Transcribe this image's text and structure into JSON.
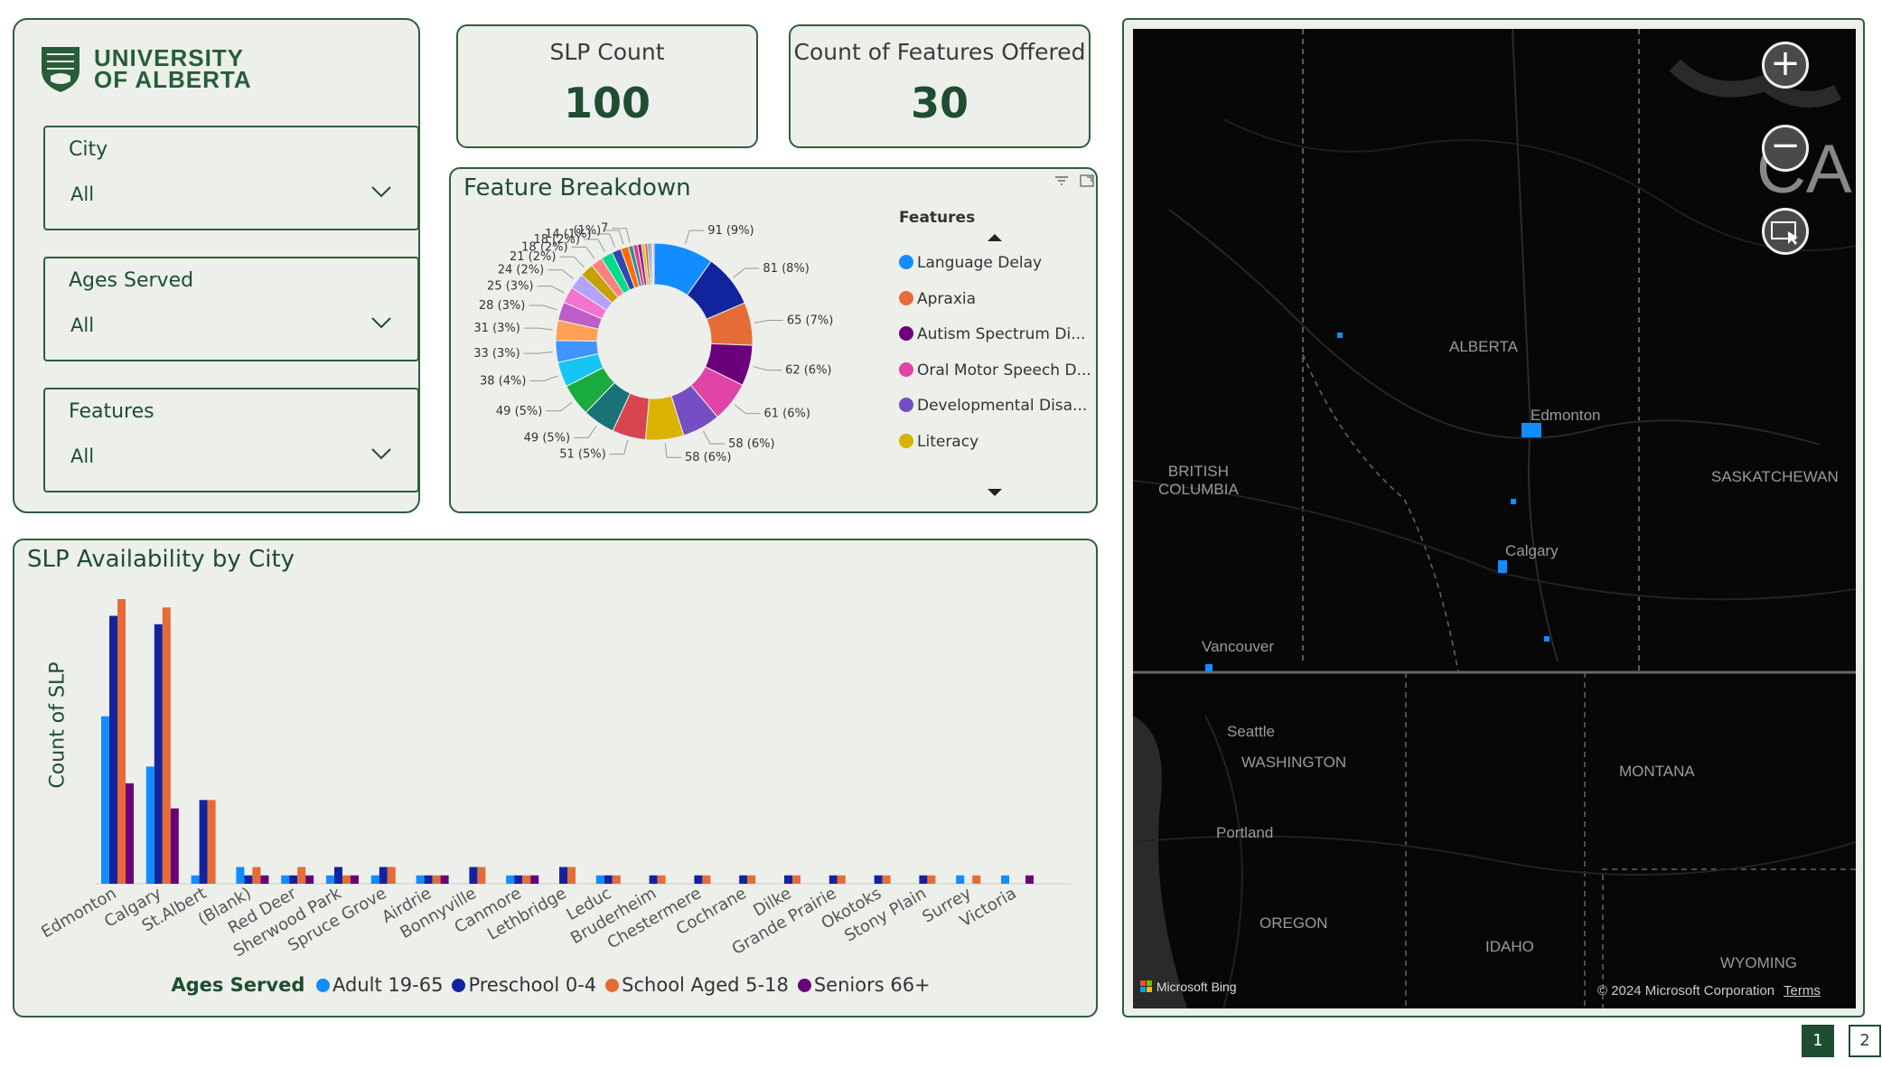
{
  "logo": {
    "line1": "UNIVERSITY",
    "line2": "OF ALBERTA"
  },
  "slicers": [
    {
      "title": "City",
      "value": "All"
    },
    {
      "title": "Ages Served",
      "value": "All"
    },
    {
      "title": "Features",
      "value": "All"
    }
  ],
  "kpis": [
    {
      "title": "SLP Count",
      "value": "100"
    },
    {
      "title": "Count of Features Offered",
      "value": "30"
    }
  ],
  "feature_breakdown": {
    "title": "Feature Breakdown",
    "legend_title": "Features",
    "legend_items": [
      {
        "label": "Language Delay",
        "color": "#118dff"
      },
      {
        "label": "Apraxia",
        "color": "#e66c37"
      },
      {
        "label": "Autism Spectrum Di...",
        "color": "#6b007b"
      },
      {
        "label": "Oral Motor Speech D...",
        "color": "#e044a7"
      },
      {
        "label": "Developmental Disa...",
        "color": "#744ec2"
      },
      {
        "label": "Literacy",
        "color": "#d9b300"
      }
    ]
  },
  "availability": {
    "title": "SLP Availability by City",
    "ylabel": "Count of SLP",
    "legend_title": "Ages Served"
  },
  "map": {
    "labels": {
      "alberta": "ALBERTA",
      "bc1": "BRITISH",
      "bc2": "COLUMBIA",
      "saskatchewan": "SASKATCHEWAN",
      "edmonton": "Edmonton",
      "calgary": "Calgary",
      "vancouver": "Vancouver",
      "seattle": "Seattle",
      "washington": "WASHINGTON",
      "montana": "MONTANA",
      "portland": "Portland",
      "oregon": "OREGON",
      "idaho": "IDAHO",
      "wyoming": "WYOMING",
      "ca": "CA"
    },
    "attribution": "Microsoft Bing",
    "copyright": "© 2024 Microsoft Corporation",
    "terms": "Terms"
  },
  "pages": [
    "1",
    "2"
  ],
  "chart_data": [
    {
      "type": "pie",
      "title": "Feature Breakdown",
      "donut": true,
      "legend_title": "Features",
      "slices": [
        {
          "label": "91 (9%)",
          "value": 91,
          "color": "#118dff"
        },
        {
          "label": "81 (8%)",
          "value": 81,
          "color": "#12239e"
        },
        {
          "label": "65 (7%)",
          "value": 65,
          "color": "#e66c37"
        },
        {
          "label": "62 (6%)",
          "value": 62,
          "color": "#6b007b"
        },
        {
          "label": "61 (6%)",
          "value": 61,
          "color": "#e044a7"
        },
        {
          "label": "58 (6%)",
          "value": 58,
          "color": "#744ec2"
        },
        {
          "label": "58 (6%)",
          "value": 58,
          "color": "#d9b300"
        },
        {
          "label": "51 (5%)",
          "value": 51,
          "color": "#d64550"
        },
        {
          "label": "49 (5%)",
          "value": 49,
          "color": "#197278"
        },
        {
          "label": "49 (5%)",
          "value": 49,
          "color": "#1aab40"
        },
        {
          "label": "38 (4%)",
          "value": 38,
          "color": "#15c6f4"
        },
        {
          "label": "33 (3%)",
          "value": 33,
          "color": "#4092ff"
        },
        {
          "label": "31 (3%)",
          "value": 31,
          "color": "#ffa058"
        },
        {
          "label": "28 (3%)",
          "value": 28,
          "color": "#be5dc9"
        },
        {
          "label": "25 (3%)",
          "value": 25,
          "color": "#f472d0"
        },
        {
          "label": "24 (2%)",
          "value": 24,
          "color": "#b5a1ff"
        },
        {
          "label": "21 (2%)",
          "value": 21,
          "color": "#c4a200"
        },
        {
          "label": "18 (2%)",
          "value": 18,
          "color": "#ff8080"
        },
        {
          "label": "18 (2%)",
          "value": 18,
          "color": "#00db8b"
        },
        {
          "label": "14 (1%)",
          "value": 14,
          "color": "#3049ad"
        },
        {
          "label": "(1%)",
          "value": 12,
          "color": "#ff6b00"
        },
        {
          "label": "7",
          "value": 7,
          "color": "#2c8c9e"
        },
        {
          "label": "",
          "value": 7,
          "color": "#d93f7f"
        },
        {
          "label": "",
          "value": 6,
          "color": "#8a1c9a"
        },
        {
          "label": "",
          "value": 5,
          "color": "#e0c000"
        },
        {
          "label": "",
          "value": 4,
          "color": "#e05050"
        },
        {
          "label": "",
          "value": 3,
          "color": "#3da66a"
        },
        {
          "label": "",
          "value": 3,
          "color": "#7a5fd0"
        },
        {
          "label": "",
          "value": 2,
          "color": "#e8a060"
        },
        {
          "label": "",
          "value": 2,
          "color": "#a0a0a0"
        }
      ]
    },
    {
      "type": "bar",
      "title": "SLP Availability by City",
      "xlabel": "",
      "ylabel": "Count of SLP",
      "categories": [
        "Edmonton",
        "Calgary",
        "St.Albert",
        "(Blank)",
        "Red Deer",
        "Sherwood Park",
        "Spruce Grove",
        "Airdrie",
        "Bonnyville",
        "Canmore",
        "Lethbridge",
        "Leduc",
        "Bruderheim",
        "Chestermere",
        "Cochrane",
        "Dilke",
        "Grande Prairie",
        "Okotoks",
        "Stony Plain",
        "Surrey",
        "Victoria"
      ],
      "ylim": [
        0,
        34
      ],
      "legend_title": "Ages Served",
      "series": [
        {
          "name": "Adult 19-65",
          "color": "#118dff",
          "values": [
            20,
            14,
            1,
            2,
            1,
            1,
            1,
            1,
            0,
            1,
            0,
            1,
            0,
            0,
            0,
            0,
            0,
            0,
            0,
            1,
            1
          ]
        },
        {
          "name": "Preschool 0-4",
          "color": "#12239e",
          "values": [
            32,
            31,
            10,
            1,
            1,
            2,
            2,
            1,
            2,
            1,
            2,
            1,
            1,
            1,
            1,
            1,
            1,
            1,
            1,
            0,
            0
          ]
        },
        {
          "name": "School Aged 5-18",
          "color": "#e66c37",
          "values": [
            34,
            33,
            10,
            2,
            2,
            1,
            2,
            1,
            2,
            1,
            2,
            1,
            1,
            1,
            1,
            1,
            1,
            1,
            1,
            1,
            0
          ]
        },
        {
          "name": "Seniors 66+",
          "color": "#6b007b",
          "values": [
            12,
            9,
            0,
            1,
            1,
            1,
            0,
            1,
            0,
            1,
            0,
            0,
            0,
            0,
            0,
            0,
            0,
            0,
            0,
            0,
            1
          ]
        }
      ]
    }
  ]
}
